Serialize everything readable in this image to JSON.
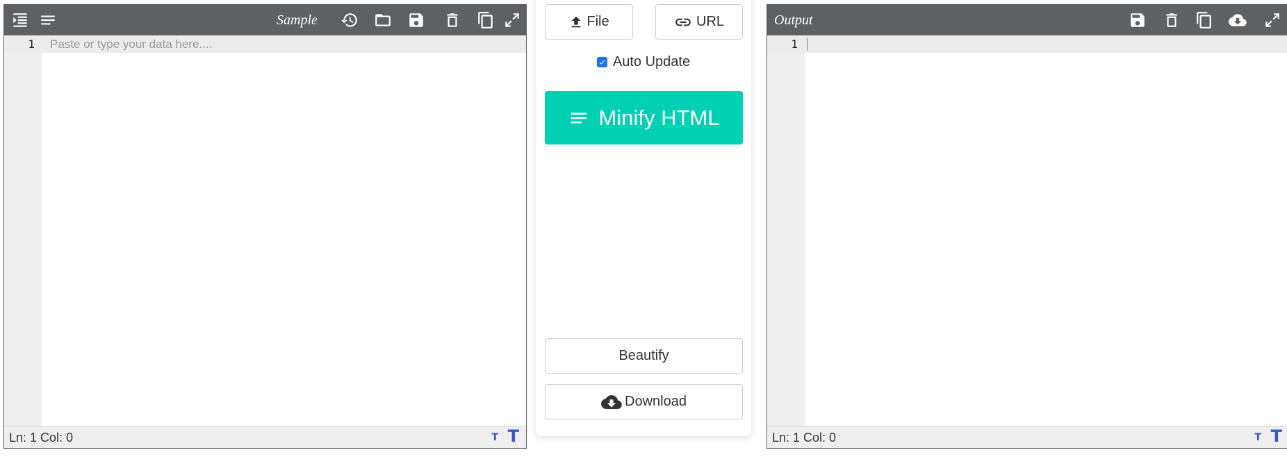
{
  "left_editor": {
    "title": "Sample",
    "line_number": "1",
    "placeholder": "Paste or type your data here....",
    "status": "Ln: 1 Col: 0",
    "font_small_label": "T",
    "font_large_label": "T",
    "toolbar_icons": [
      "indent-icon",
      "wrap-lines-icon",
      "history-icon",
      "folder-icon",
      "save-icon",
      "delete-icon",
      "copy-icon",
      "fullscreen-icon"
    ]
  },
  "middle": {
    "file_label": "File",
    "url_label": "URL",
    "auto_update_label": "Auto Update",
    "auto_update_checked": true,
    "minify_label": "Minify HTML",
    "beautify_label": "Beautify",
    "download_label": "Download",
    "accent_color": "#00d1b2"
  },
  "right_editor": {
    "title": "Output",
    "line_number": "1",
    "status": "Ln: 1 Col: 0",
    "font_small_label": "T",
    "font_large_label": "T",
    "toolbar_icons": [
      "save-icon",
      "delete-icon",
      "copy-icon",
      "cloud-download-icon",
      "fullscreen-icon"
    ]
  },
  "colors": {
    "toolbar_bg": "#5f6063",
    "gutter_bg": "#efefef",
    "font_size_icon": "#3b55c9"
  }
}
